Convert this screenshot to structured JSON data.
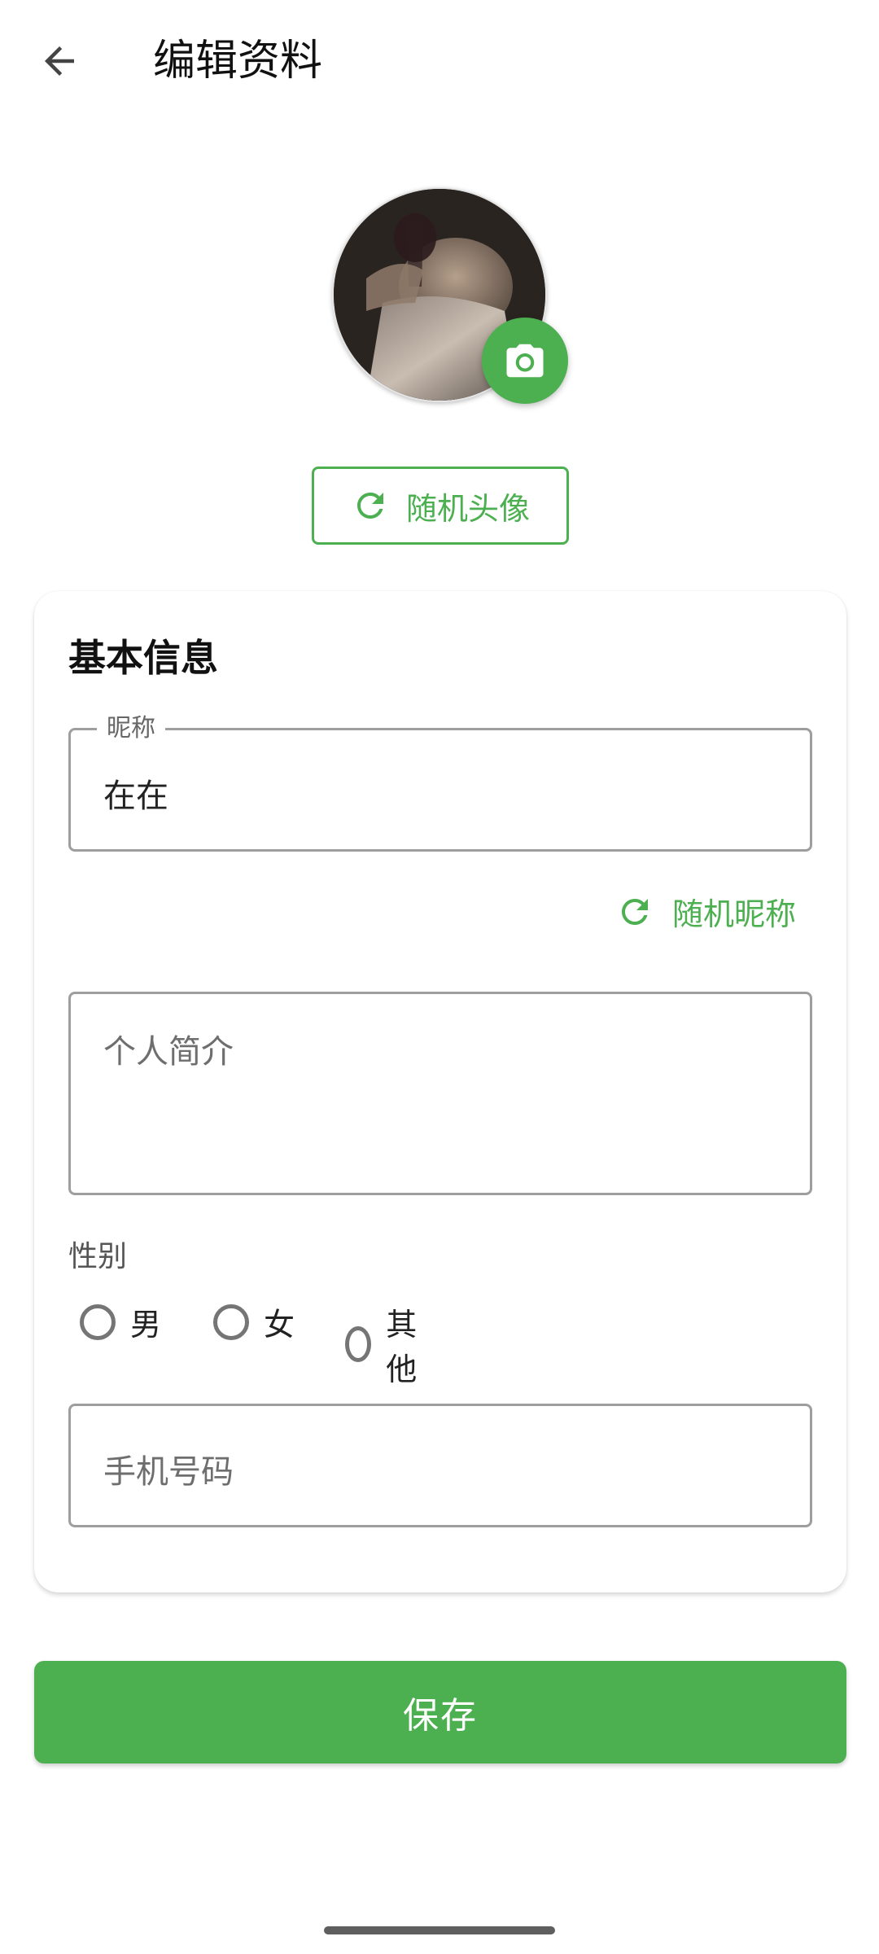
{
  "header": {
    "title": "编辑资料"
  },
  "avatar": {
    "random_label": "随机头像"
  },
  "profile": {
    "section_title": "基本信息",
    "nickname": {
      "label": "昵称",
      "value": "在在"
    },
    "random_nickname_label": "随机昵称",
    "bio": {
      "placeholder": "个人简介"
    },
    "gender": {
      "label": "性别",
      "options": [
        "男",
        "女",
        "其他"
      ]
    },
    "phone": {
      "placeholder": "手机号码"
    }
  },
  "actions": {
    "save_label": "保存"
  },
  "icons": {
    "back": "arrow-back-icon",
    "camera": "camera-icon",
    "refresh": "refresh-icon"
  },
  "colors": {
    "accent": "#4caf50",
    "border": "#9e9e9e"
  }
}
